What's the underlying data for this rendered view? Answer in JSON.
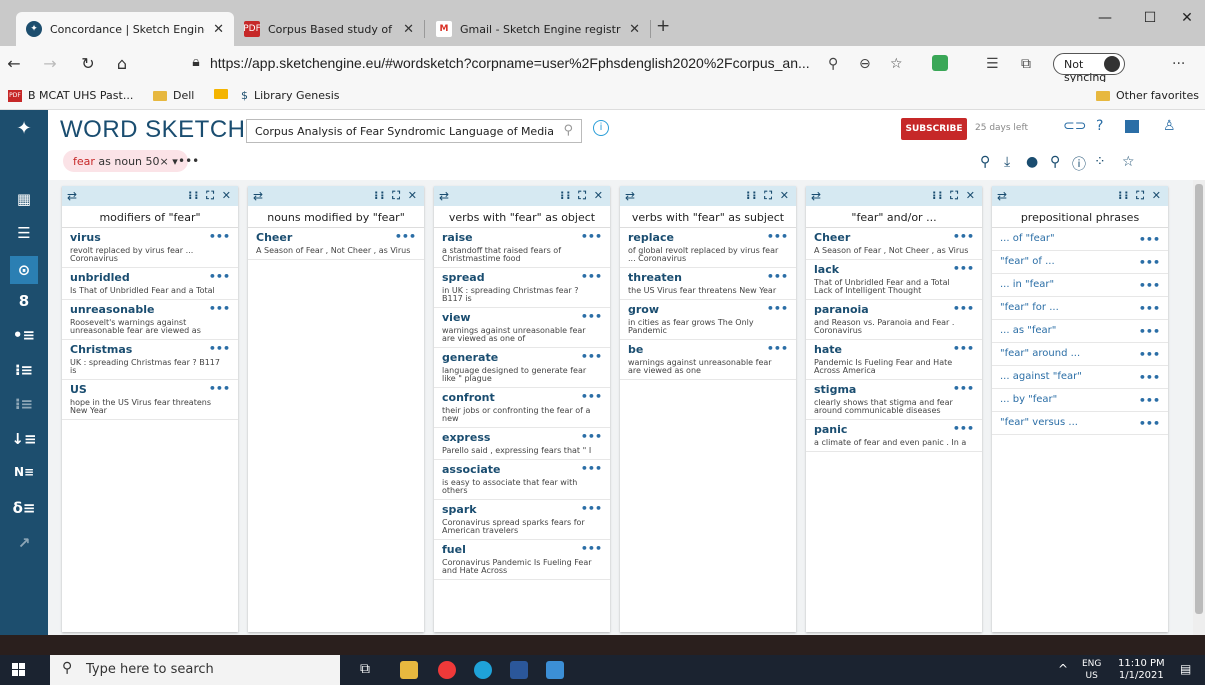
{
  "browser": {
    "tabs": [
      {
        "title": "Concordance | Sketch Engine",
        "icon": "sketch-engine-icon"
      },
      {
        "title": "Corpus Based study of Prooun'w",
        "icon": "pdf-icon"
      },
      {
        "title": "Gmail - Sketch Engine registratio",
        "icon": "gmail-icon"
      }
    ],
    "new_tab": "+",
    "url": "https://app.sketchengine.eu/#wordsketch?corpname=user%2Fphsdenglish2020%2Fcorpus_an...",
    "sync_label": "Not syncing",
    "bookmarks": [
      "B MCAT UHS Past...",
      "Dell",
      "Library Genesis"
    ],
    "other_favorites": "Other favorites"
  },
  "app": {
    "title": "WORD SKETCH",
    "corpus_name": "Corpus Analysis of Fear Syndromic Language of Media",
    "subscribe": "SUBSCRIBE",
    "days_left": "25 days left",
    "query_lemma": "fear",
    "query_rest": " as noun 50× ▾",
    "more": "•••"
  },
  "columns": [
    {
      "title": "modifiers of \"fear\"",
      "items": [
        {
          "word": "virus",
          "example": "revolt replaced by virus fear ...\nCoronavirus"
        },
        {
          "word": "unbridled",
          "example": "Is That of Unbridled Fear and a Total"
        },
        {
          "word": "unreasonable",
          "example": "Roosevelt's warnings against\nunreasonable fear are viewed as"
        },
        {
          "word": "Christmas",
          "example": "UK : spreading Christmas fear ? B117\nis"
        },
        {
          "word": "US",
          "example": "hope in the US Virus fear threatens\nNew Year"
        }
      ]
    },
    {
      "title": "nouns modified by \"fear\"",
      "items": [
        {
          "word": "Cheer",
          "example": "A Season of Fear , Not Cheer , as Virus"
        }
      ]
    },
    {
      "title": "verbs with \"fear\" as object",
      "items": [
        {
          "word": "raise",
          "example": "a standoff that raised fears of\nChristmastime food"
        },
        {
          "word": "spread",
          "example": "in UK : spreading Christmas fear ?\nB117 is"
        },
        {
          "word": "view",
          "example": "warnings against unreasonable fear\nare viewed as one of"
        },
        {
          "word": "generate",
          "example": "language designed to generate fear\nlike \" plague"
        },
        {
          "word": "confront",
          "example": "their jobs or confronting the fear of a\nnew"
        },
        {
          "word": "express",
          "example": "Parello said , expressing fears that \" I"
        },
        {
          "word": "associate",
          "example": "is easy to associate that fear with\nothers"
        },
        {
          "word": "spark",
          "example": "Coronavirus spread sparks fears for\nAmerican travelers"
        },
        {
          "word": "fuel",
          "example": "Coronavirus Pandemic Is Fueling Fear\nand Hate Across"
        }
      ]
    },
    {
      "title": "verbs with \"fear\" as subject",
      "items": [
        {
          "word": "replace",
          "example": "of global revolt replaced by virus fear\n... Coronavirus"
        },
        {
          "word": "threaten",
          "example": "the US Virus fear threatens New Year"
        },
        {
          "word": "grow",
          "example": "in cities as fear grows The Only\nPandemic"
        },
        {
          "word": "be",
          "example": "warnings against unreasonable fear\nare viewed as one"
        }
      ]
    },
    {
      "title": "\"fear\" and/or ...",
      "items": [
        {
          "word": "Cheer",
          "example": "A Season of Fear , Not Cheer , as Virus"
        },
        {
          "word": "lack",
          "example": "That of Unbridled Fear and a Total\nLack of Intelligent Thought"
        },
        {
          "word": "paranoia",
          "example": "and Reason vs. Paranoia and Fear .\nCoronavirus"
        },
        {
          "word": "hate",
          "example": "Pandemic Is Fueling Fear and Hate\nAcross America"
        },
        {
          "word": "stigma",
          "example": "clearly shows that stigma and fear\naround communicable diseases"
        },
        {
          "word": "panic",
          "example": "a climate of fear and even panic . In a"
        }
      ]
    },
    {
      "title": "prepositional phrases",
      "phrases": [
        "... of \"fear\"",
        "\"fear\" of ...",
        "... in \"fear\"",
        "\"fear\" for ...",
        "... as \"fear\"",
        "\"fear\" around ...",
        "... against \"fear\"",
        "... by \"fear\"",
        "\"fear\" versus ..."
      ]
    }
  ],
  "taskbar": {
    "search_placeholder": "Type here to search",
    "lang": "ENG",
    "region": "US",
    "time": "11:10 PM",
    "date": "1/1/2021"
  },
  "colors": {
    "accent": "#1a4d70",
    "sidebar": "#1d4e6e",
    "subscribe": "#c62828",
    "column_header": "#d6e9f2"
  }
}
